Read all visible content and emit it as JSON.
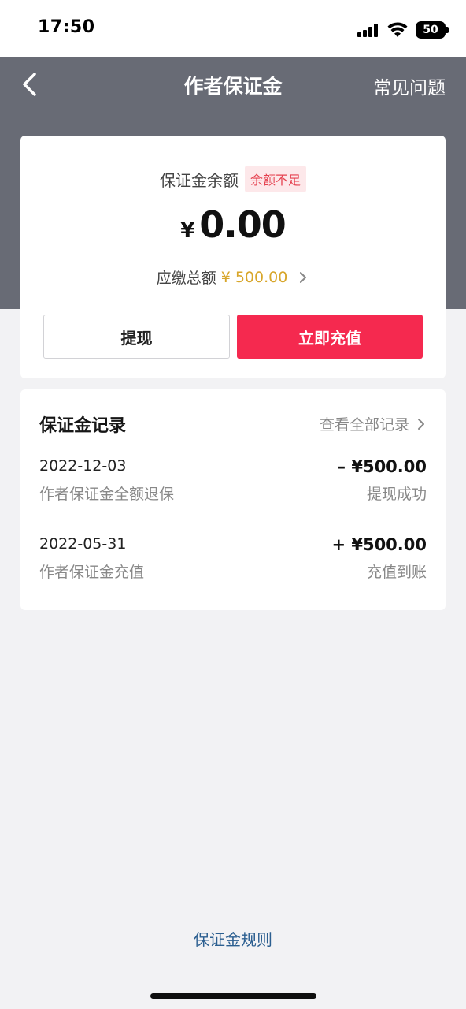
{
  "status_bar": {
    "time": "17:50",
    "battery": "50"
  },
  "nav": {
    "title": "作者保证金",
    "faq_label": "常见问题"
  },
  "balance": {
    "label": "保证金余额",
    "badge": "余额不足",
    "currency": "¥",
    "amount": "0.00",
    "due_label": "应缴总额",
    "due_amount": "¥ 500.00",
    "withdraw_label": "提现",
    "recharge_label": "立即充值"
  },
  "records": {
    "title": "保证金记录",
    "view_all_label": "查看全部记录",
    "items": [
      {
        "date": "2022-12-03",
        "description": "作者保证金全额退保",
        "amount": "– ¥500.00",
        "status": "提现成功"
      },
      {
        "date": "2022-05-31",
        "description": "作者保证金充值",
        "amount": "+ ¥500.00",
        "status": "充值到账"
      }
    ]
  },
  "footer": {
    "rules_link": "保证金规则"
  },
  "colors": {
    "header_bg": "#686b75",
    "accent": "#f5294f",
    "due_amount": "#d8a62a",
    "badge_text": "#e5414f",
    "link": "#2c5f90"
  },
  "icons": [
    "signal-icon",
    "wifi-icon",
    "battery-icon",
    "back-arrow-icon",
    "chevron-right-icon"
  ]
}
